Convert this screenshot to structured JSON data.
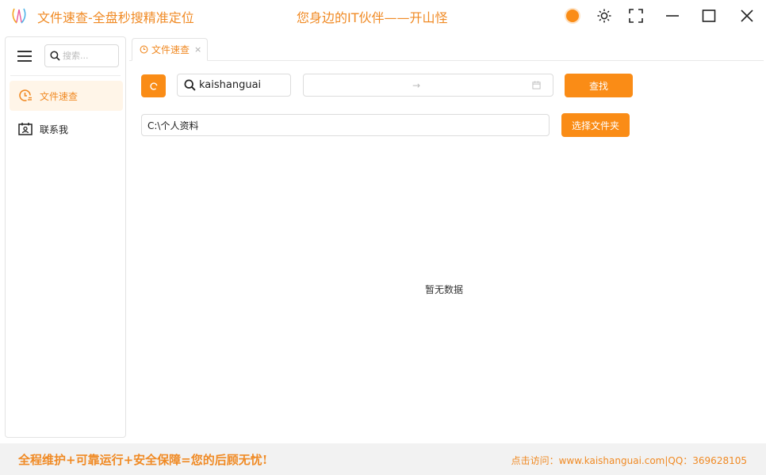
{
  "window": {
    "title": "文件速查-全盘秒搜精准定位",
    "slogan": "您身边的IT伙伴——开山怪",
    "accent_color": "#fa8c16"
  },
  "sidebar": {
    "search_placeholder": "搜索...",
    "items": [
      {
        "label": "文件速查",
        "icon": "clock-search-icon",
        "active": true
      },
      {
        "label": "联系我",
        "icon": "contact-card-icon",
        "active": false
      }
    ]
  },
  "tabs": [
    {
      "label": "文件速查",
      "icon": "clock-icon",
      "close": "×"
    }
  ],
  "toolbar": {
    "keyword_value": "kaishanguai",
    "date_separator": "→",
    "search_button": "查找"
  },
  "path": {
    "value": "C:\\个人资料",
    "choose_button": "选择文件夹"
  },
  "results": {
    "empty_text": "暂无数据"
  },
  "footer": {
    "slogan": "全程维护+可靠运行+安全保障=您的后顾无忧!",
    "contact": "点击访问：www.kaishanguai.com|QQ：369628105"
  }
}
